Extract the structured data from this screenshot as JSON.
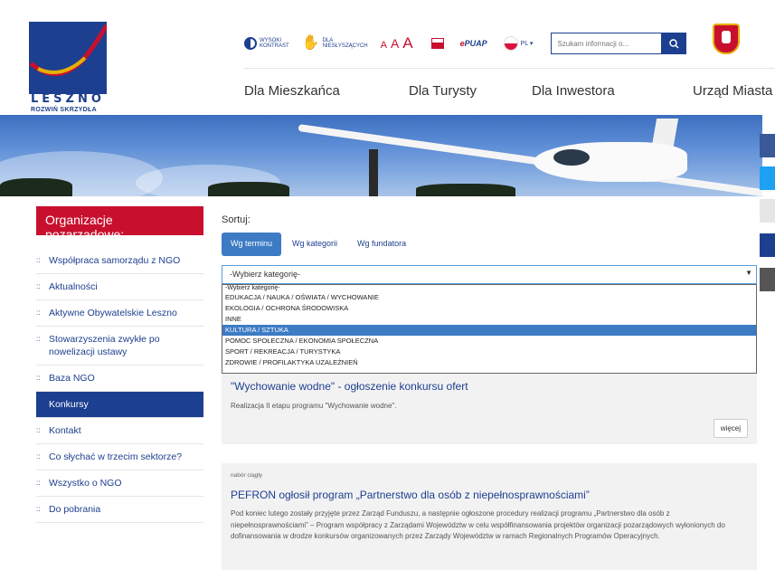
{
  "header": {
    "logo_text": "LESZNO",
    "logo_sub": "ROZWIŃ SKRZYDŁA",
    "contrast_line1": "WYSOKI",
    "contrast_line2": "KONTRAST",
    "disabled_line1": "DLA",
    "disabled_line2": "NIESŁYSZĄCYCH",
    "font_small": "A",
    "font_medium": "A",
    "font_large": "A",
    "epuap": "ePUAP",
    "lang": "PL ▾",
    "search_placeholder": "Szukam informacji o..."
  },
  "nav": {
    "items": [
      "Dla Mieszkańca",
      "Dla Turysty",
      "Dla Inwestora",
      "Urząd Miasta"
    ]
  },
  "sidebar": {
    "title": "Organizacje pozarządowe:",
    "items": [
      "Współpraca samorządu z NGO",
      "Aktualności",
      "Aktywne Obywatelskie Leszno",
      "Stowarzyszenia zwykłe po nowelizacji ustawy",
      "Baza NGO",
      "Konkursy",
      "Kontakt",
      "Co słychać w trzecim sektorze?",
      "Wszystko o NGO",
      "Do pobrania"
    ]
  },
  "main": {
    "sort_label": "Sortuj:",
    "tabs": [
      "Wg terminu",
      "Wg kategorii",
      "Wg fundatora"
    ],
    "select_value": "-Wybierz kategorię-",
    "dropdown_options": [
      "-Wybierz kategorię-",
      "EDUKACJA / NAUKA / OŚWIATA / WYCHOWANIE",
      "EKOLOGIA / OCHRONA ŚRODOWISKA",
      "INNE",
      "KULTURA / SZTUKA",
      "POMOC SPOŁECZNA / EKONOMIA SPOŁECZNA",
      "SPORT / REKREACJA / TURYSTYKA",
      "ZDROWIE / PROFILAKTYKA UZALEŻNIEŃ"
    ],
    "card1": {
      "title": "\"Wychowanie wodne\" - ogłoszenie konkursu ofert",
      "text": "Realizacja II etapu programu \"Wychowanie wodne\".",
      "more": "więcej"
    },
    "card2": {
      "tag": "nabór ciągły",
      "title": "PEFRON ogłosił program „Partnerstwo dla osób z niepełnosprawnościami”",
      "text": "Pod koniec lutego zostały przyjęte przez Zarząd Funduszu, a następnie ogłoszone procedury realizacji programu „Partnerstwo dla osób z niepełnosprawnościami” – Program współpracy z Zarządami Województw w celu współfinansowania projektów organizacji pozarządowych wyłonionych do dofinansowania w drodze konkursów organizowanych przez Zarządy Województw w ramach Regionalnych Programów Operacyjnych."
    }
  },
  "colors": {
    "brand_blue": "#1d3f8f",
    "brand_red": "#c8102e"
  }
}
